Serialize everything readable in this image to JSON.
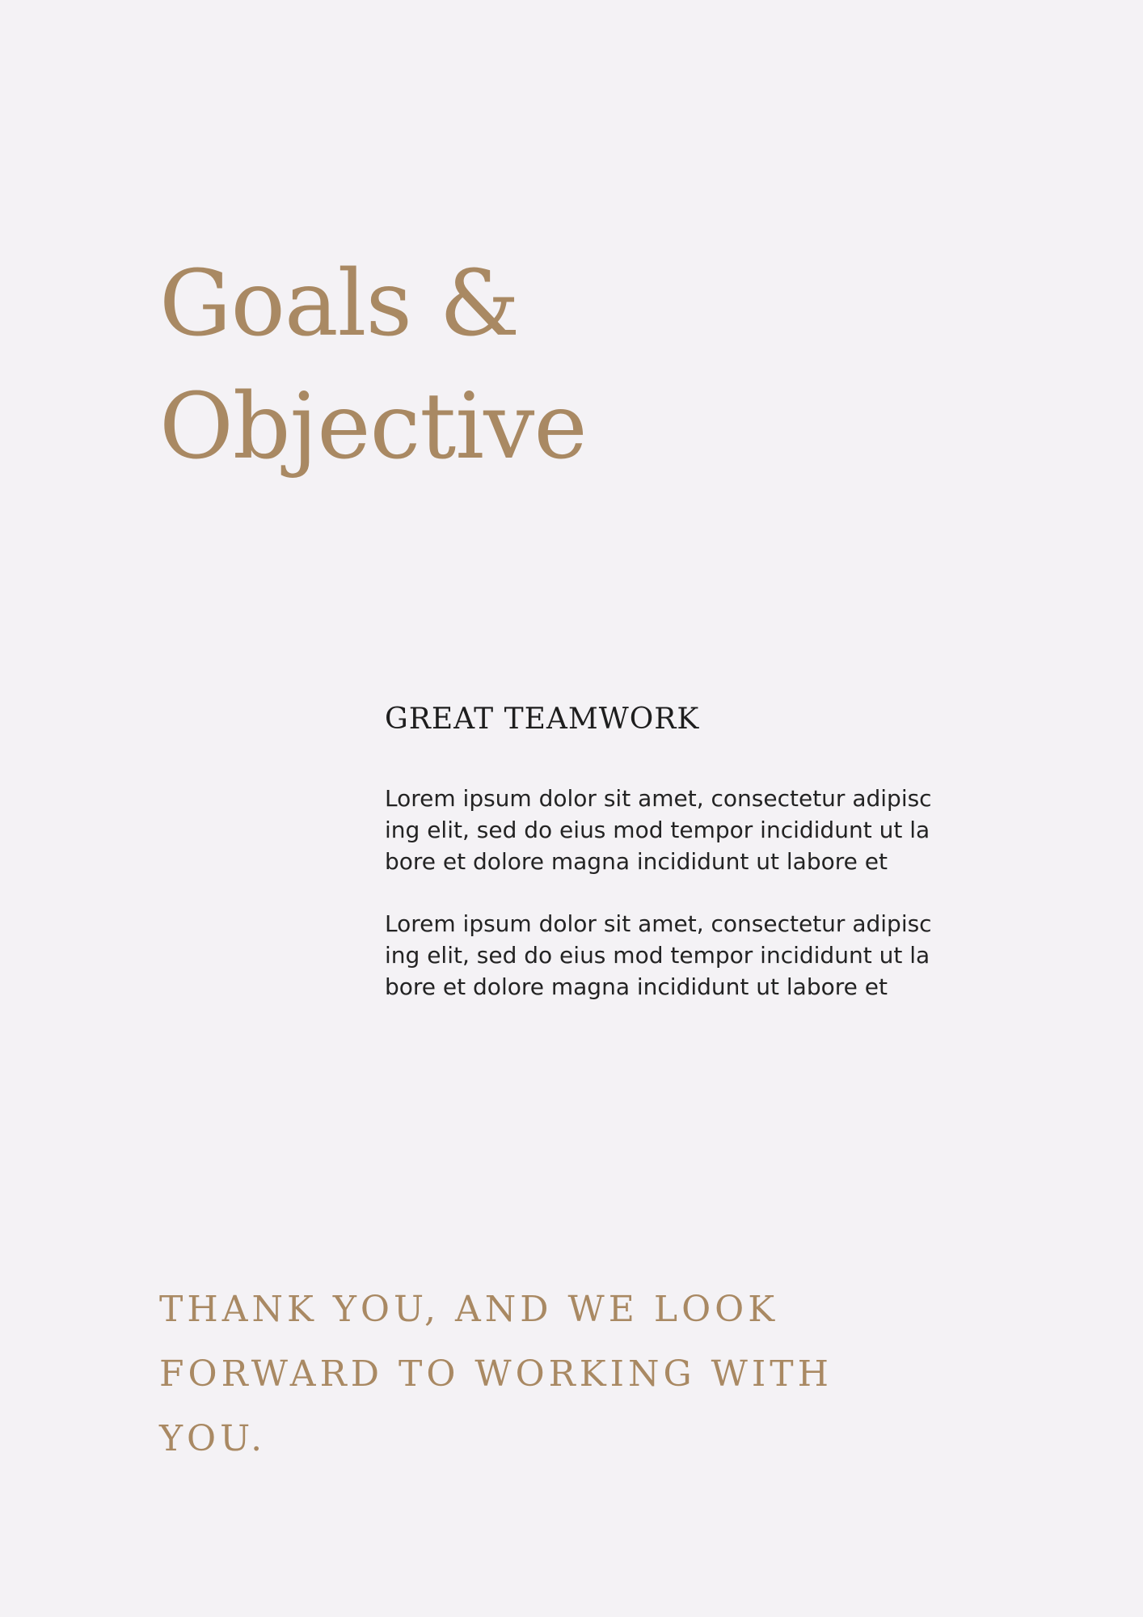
{
  "title": {
    "line1": "Goals &",
    "line2": "Objective"
  },
  "section": {
    "heading": "GREAT TEAMWORK",
    "paragraphs": [
      "Lorem ipsum dolor sit amet, consectetur adipiscing elit, sed do eius mod tempor incididunt ut labore et dolore magna  incididunt ut labore et",
      "Lorem ipsum dolor sit amet, consectetur adipiscing elit, sed do eius mod tempor incididunt ut labore et dolore magna  incididunt ut labore et"
    ]
  },
  "closing": "THANK YOU, AND WE LOOK FORWARD TO WORKING WITH YOU.",
  "colors": {
    "background": "#f4f2f5",
    "accent": "#a98963",
    "text": "#232323"
  }
}
